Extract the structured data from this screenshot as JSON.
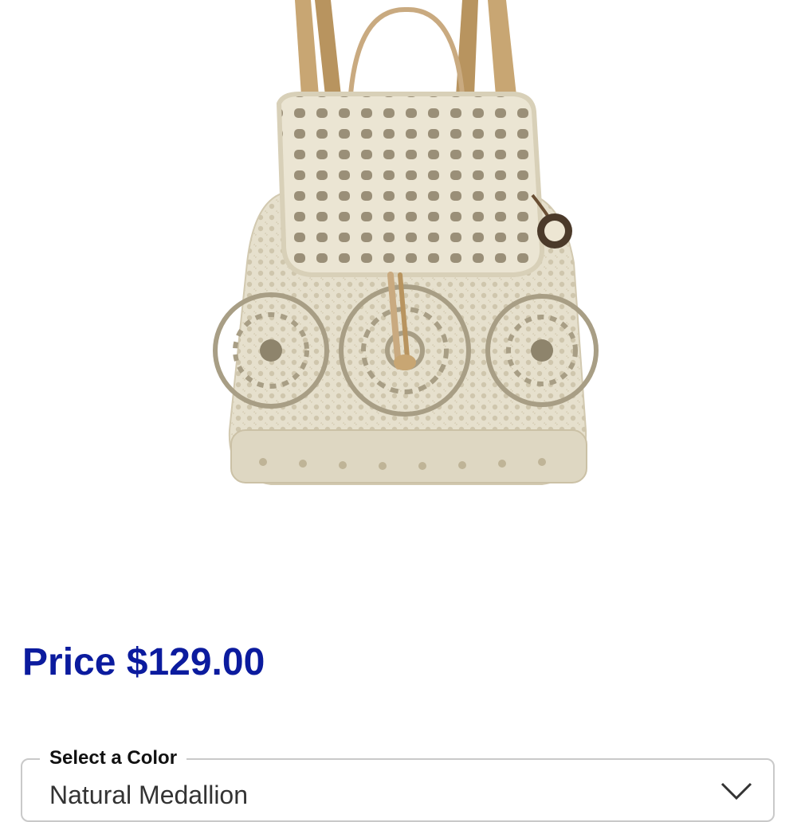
{
  "product": {
    "image_alt": "Crochet backpack",
    "price_label": "Price $129.00"
  },
  "color_select": {
    "legend": "Select a Color",
    "selected_value": "Natural Medallion",
    "icon": "chevron-down-icon"
  }
}
